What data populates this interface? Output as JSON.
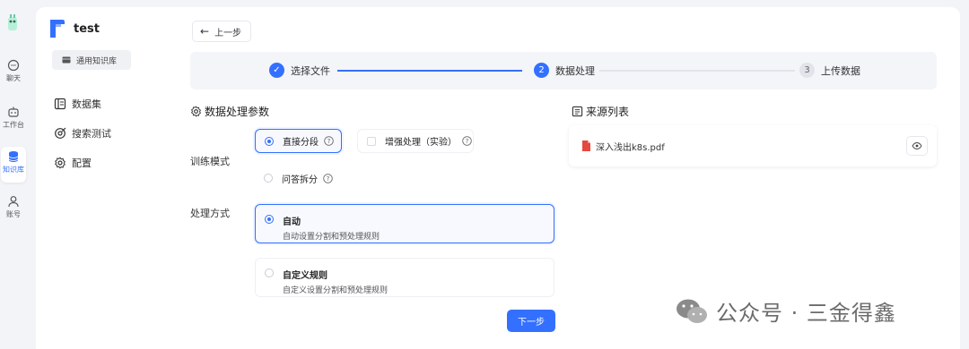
{
  "rail": {
    "items": [
      {
        "label": "聊天",
        "icon": "chat-icon"
      },
      {
        "label": "工作台",
        "icon": "robot-icon"
      },
      {
        "label": "知识库",
        "icon": "database-icon",
        "active": true
      },
      {
        "label": "账号",
        "icon": "user-icon"
      }
    ]
  },
  "sidebar": {
    "app_name": "test",
    "kb_type": "通用知识库",
    "nav": [
      {
        "label": "数据集",
        "icon": "dataset-icon"
      },
      {
        "label": "搜索测试",
        "icon": "search-test-icon"
      },
      {
        "label": "配置",
        "icon": "gear-icon"
      }
    ]
  },
  "main": {
    "back_label": "上一步",
    "steps": [
      {
        "index": "✓",
        "label": "选择文件",
        "state": "done"
      },
      {
        "index": "2",
        "label": "数据处理",
        "state": "current"
      },
      {
        "index": "3",
        "label": "上传数据",
        "state": "todo"
      }
    ],
    "params_title": "数据处理参数",
    "train_mode_label": "训练模式",
    "train_modes": [
      {
        "label": "直接分段",
        "selected": true
      },
      {
        "label": "增强处理（实验）",
        "selected": false
      },
      {
        "label": "问答拆分",
        "selected": false
      }
    ],
    "process_label": "处理方式",
    "process_modes": [
      {
        "title": "自动",
        "desc": "自动设置分割和预处理规则",
        "selected": true
      },
      {
        "title": "自定义规则",
        "desc": "自定义设置分割和预处理规则",
        "selected": false
      }
    ],
    "next_label": "下一步",
    "source_title": "来源列表",
    "files": [
      {
        "name": "深入浅出k8s.pdf"
      }
    ]
  },
  "watermark": {
    "text": "公众号 · 三金得鑫"
  },
  "colors": {
    "accent": "#3370ff",
    "background": "#f3f4f8",
    "panel": "#ffffff"
  }
}
